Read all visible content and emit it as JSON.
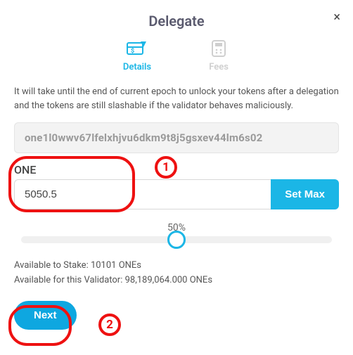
{
  "modal": {
    "title": "Delegate",
    "close_symbol": "×",
    "tabs": {
      "details": "Details",
      "fees": "Fees"
    },
    "info_text": "It will take until the end of current epoch to unlock your tokens after a delegation and the tokens are still slashable if the validator behaves maliciously.",
    "address": "one1l0wwv67lfelxhjvu6dkm9t8j5gsxev44lm6s02",
    "amount": {
      "label": "ONE",
      "value": "5050.5",
      "set_max_label": "Set Max"
    },
    "slider": {
      "percent_label": "50%"
    },
    "available_stake": "Available to Stake: 10101 ONEs",
    "available_validator": "Available for this Validator: 98,189,064.000 ONEs",
    "next_label": "Next"
  },
  "annotations": {
    "one": "1",
    "two": "2"
  }
}
